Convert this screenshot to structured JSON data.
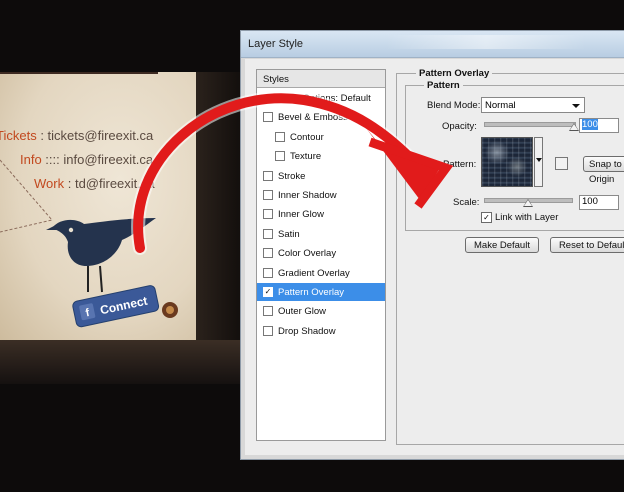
{
  "card": {
    "lines": [
      {
        "label": "Tickets",
        "sep": " : ",
        "value": "tickets@fireexit.ca"
      },
      {
        "label": "Info",
        "sep": " :::: ",
        "value": "info@fireexit.ca"
      },
      {
        "label": "Work",
        "sep": " : ",
        "value": "td@fireexit.ca"
      }
    ],
    "connect_label": "Connect",
    "fb_letter": "f"
  },
  "window": {
    "title": "Layer Style",
    "styles_header": "Styles",
    "style_items": [
      {
        "label": "Blending Options: Default",
        "checkbox": false,
        "checked": false,
        "indent": 0
      },
      {
        "label": "Bevel & Emboss",
        "checkbox": true,
        "checked": false,
        "indent": 0
      },
      {
        "label": "Contour",
        "checkbox": true,
        "checked": false,
        "indent": 1
      },
      {
        "label": "Texture",
        "checkbox": true,
        "checked": false,
        "indent": 1
      },
      {
        "label": "Stroke",
        "checkbox": true,
        "checked": false,
        "indent": 0
      },
      {
        "label": "Inner Shadow",
        "checkbox": true,
        "checked": false,
        "indent": 0
      },
      {
        "label": "Inner Glow",
        "checkbox": true,
        "checked": false,
        "indent": 0
      },
      {
        "label": "Satin",
        "checkbox": true,
        "checked": false,
        "indent": 0
      },
      {
        "label": "Color Overlay",
        "checkbox": true,
        "checked": false,
        "indent": 0
      },
      {
        "label": "Gradient Overlay",
        "checkbox": true,
        "checked": false,
        "indent": 0
      },
      {
        "label": "Pattern Overlay",
        "checkbox": true,
        "checked": true,
        "indent": 0,
        "selected": true
      },
      {
        "label": "Outer Glow",
        "checkbox": true,
        "checked": false,
        "indent": 0
      },
      {
        "label": "Drop Shadow",
        "checkbox": true,
        "checked": false,
        "indent": 0
      }
    ],
    "panel": {
      "group_title": "Pattern Overlay",
      "subgroup_title": "Pattern",
      "blend_mode_label": "Blend Mode:",
      "blend_mode_value": "Normal",
      "opacity_label": "Opacity:",
      "opacity_value": "100",
      "opacity_level": 1.0,
      "pattern_label": "Pattern:",
      "snap_button": "Snap to Origin",
      "scale_label": "Scale:",
      "scale_value": "100",
      "scale_level": 0.5,
      "link_label": "Link with Layer",
      "link_checked": true,
      "make_default_button": "Make Default",
      "reset_default_button": "Reset to Default"
    }
  },
  "colors": {
    "accent_red": "#e11b1b",
    "selection_blue": "#3c8ee8",
    "card_label": "#c2491f"
  }
}
